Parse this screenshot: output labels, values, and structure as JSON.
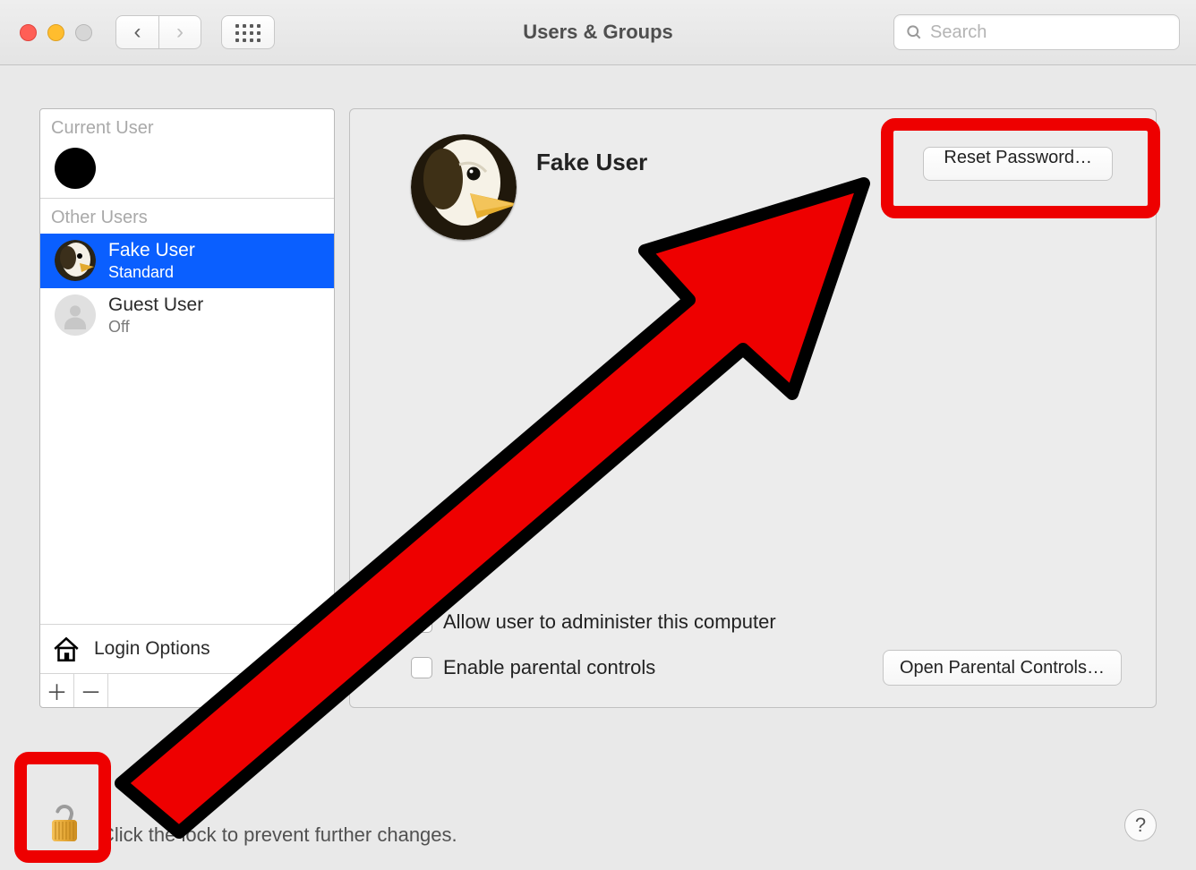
{
  "toolbar": {
    "title": "Users & Groups",
    "search_placeholder": "Search"
  },
  "sidebar": {
    "current_label": "Current User",
    "other_label": "Other Users",
    "login_options_label": "Login Options",
    "other_users": [
      {
        "name": "Fake User",
        "sub": "Standard",
        "selected": true
      },
      {
        "name": "Guest User",
        "sub": "Off",
        "selected": false
      }
    ]
  },
  "main": {
    "user_name": "Fake User",
    "reset_label": "Reset Password…",
    "admin_label": "Allow user to administer this computer",
    "parental_label": "Enable parental controls",
    "open_parental_label": "Open Parental Controls…"
  },
  "footer": {
    "lock_text": "Click the lock to prevent further changes."
  }
}
